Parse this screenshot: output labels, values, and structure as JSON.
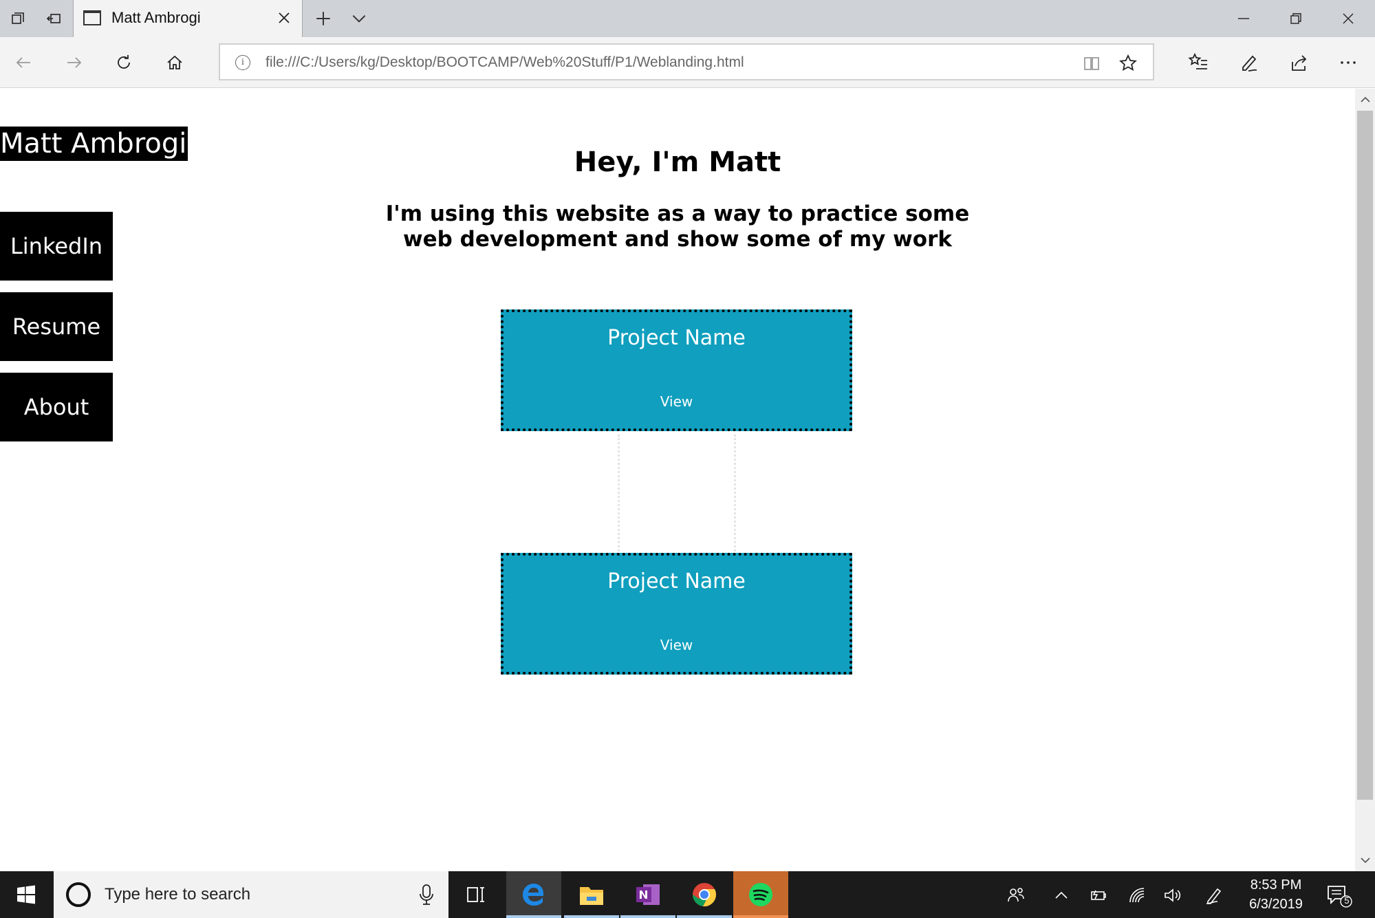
{
  "browser": {
    "tab": {
      "title": "Matt Ambrogi"
    },
    "address": {
      "url": "file:///C:/Users/kg/Desktop/BOOTCAMP/Web%20Stuff/P1/Weblanding.html"
    }
  },
  "page": {
    "logo": "Matt Ambrogi",
    "nav": [
      {
        "label": "LinkedIn"
      },
      {
        "label": "Resume"
      },
      {
        "label": "About"
      }
    ],
    "heading": "Hey, I'm Matt",
    "subheading": "I'm using this website as a way to practice some web development and show some of my work",
    "projects": [
      {
        "name": "Project Name",
        "action": "View"
      },
      {
        "name": "Project Name",
        "action": "View"
      }
    ],
    "colors": {
      "card": "#109fbe",
      "nav": "#000000"
    }
  },
  "taskbar": {
    "search_placeholder": "Type here to search",
    "time": "8:53 PM",
    "date": "6/3/2019",
    "notification_count": "5"
  }
}
